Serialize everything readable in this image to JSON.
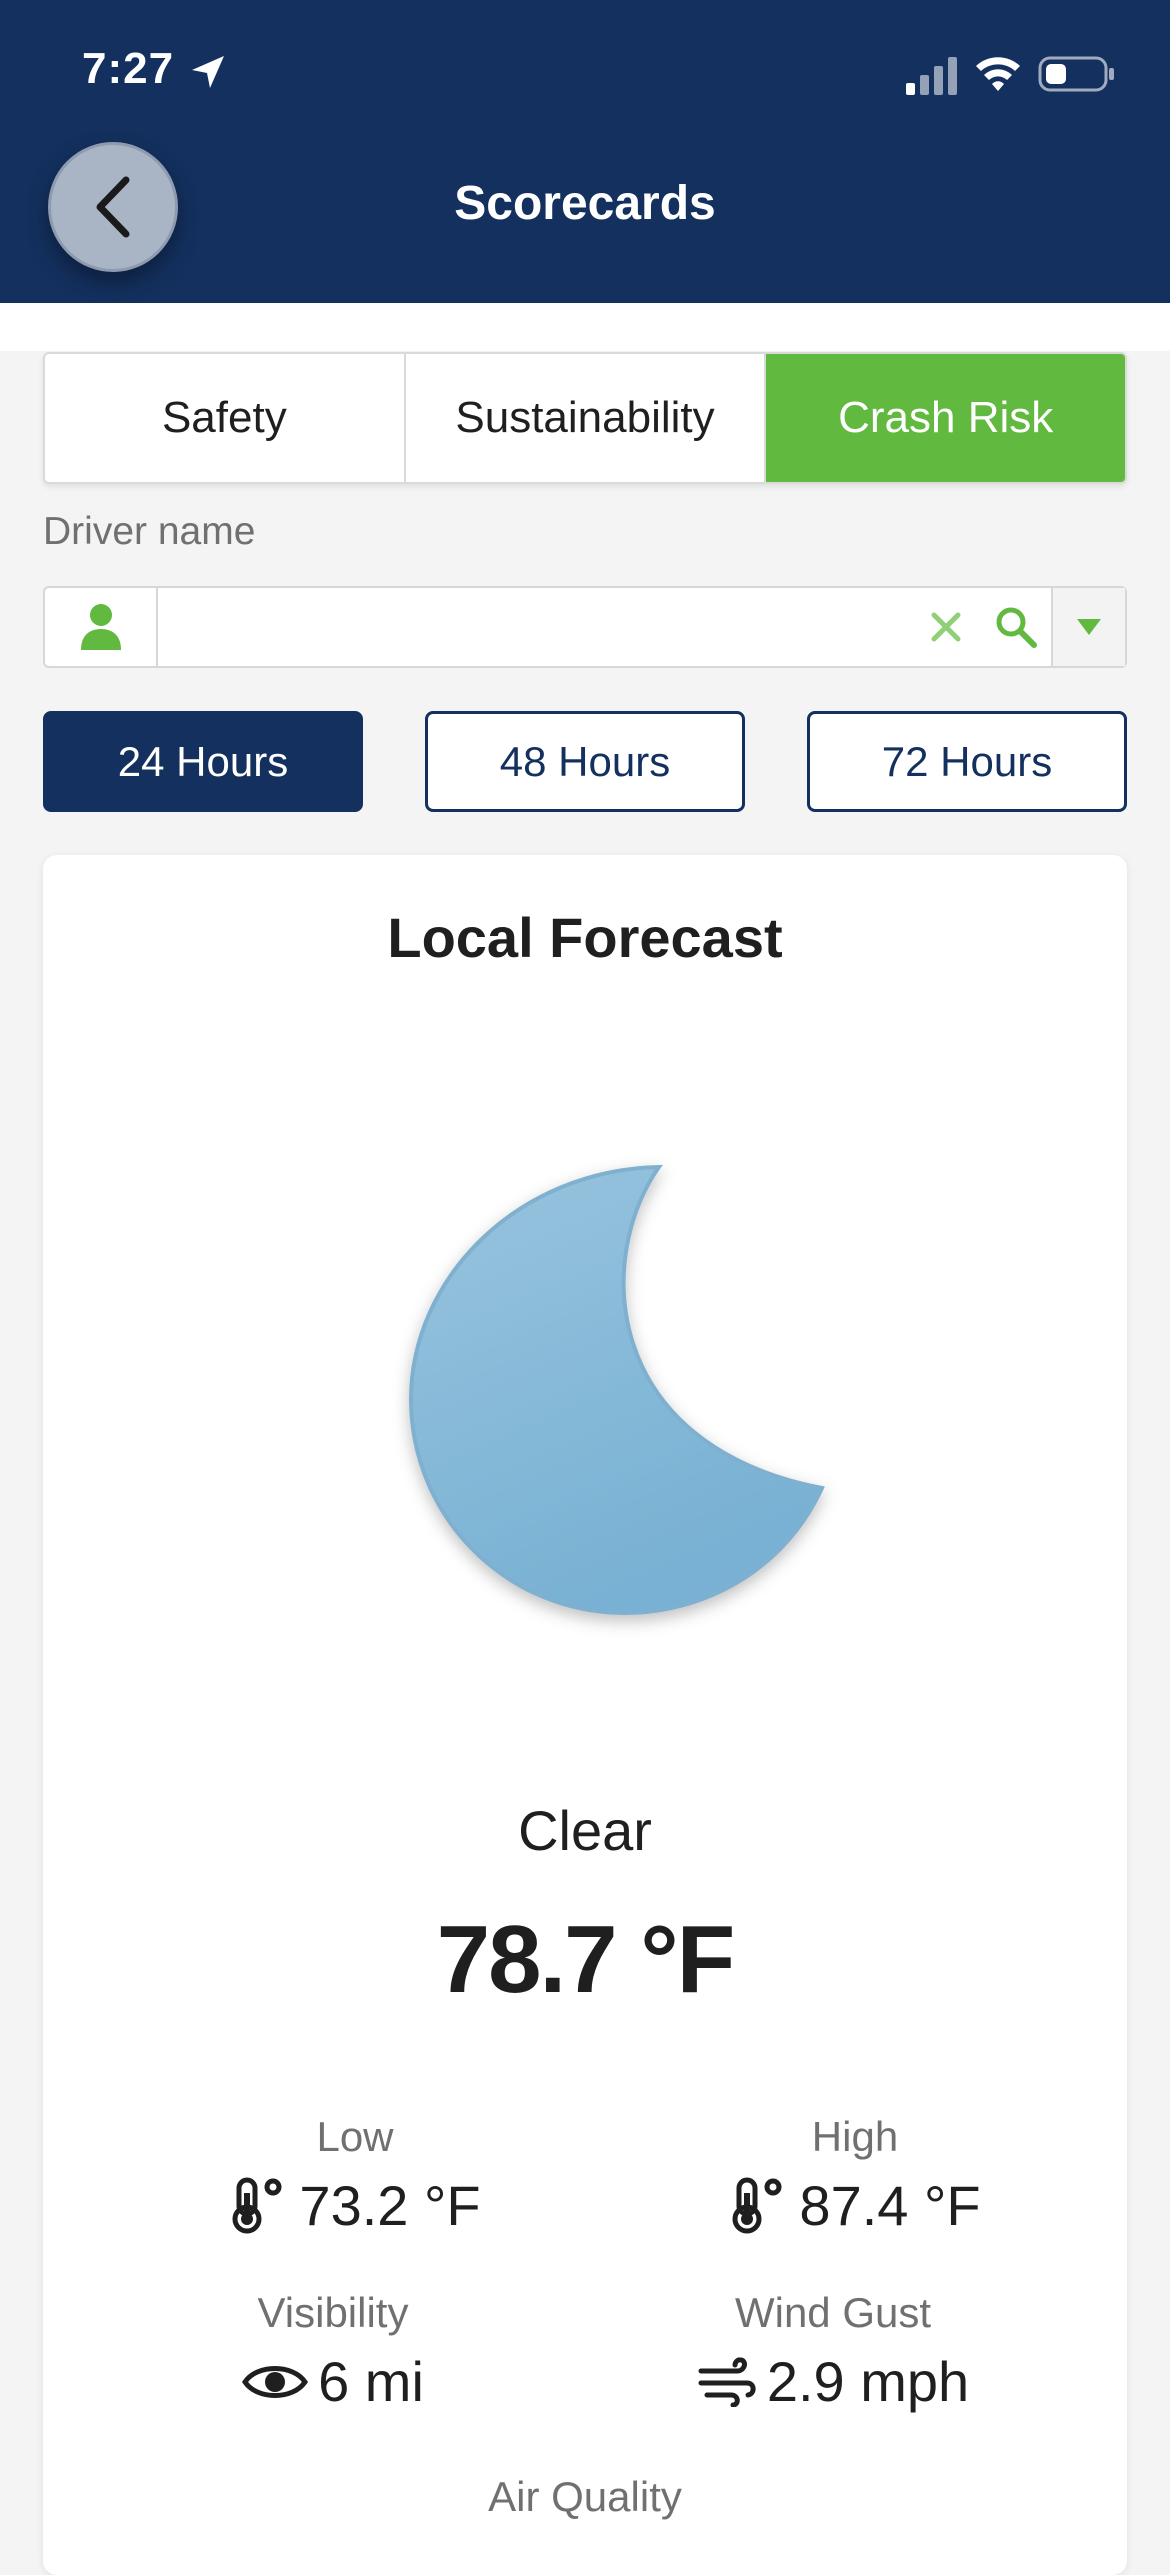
{
  "status_bar": {
    "time": "7:27"
  },
  "header": {
    "title": "Scorecards"
  },
  "tabs": [
    {
      "label": "Safety",
      "active": false
    },
    {
      "label": "Sustainability",
      "active": false
    },
    {
      "label": "Crash Risk",
      "active": true
    }
  ],
  "driver": {
    "label": "Driver name",
    "value": "",
    "placeholder": ""
  },
  "hour_filters": [
    {
      "label": "24 Hours",
      "active": true
    },
    {
      "label": "48 Hours",
      "active": false
    },
    {
      "label": "72 Hours",
      "active": false
    }
  ],
  "forecast": {
    "title": "Local Forecast",
    "condition": "Clear",
    "temperature": "78.7 °F",
    "low_label": "Low",
    "low_value": "73.2 °F",
    "high_label": "High",
    "high_value": "87.4 °F",
    "visibility_label": "Visibility",
    "visibility_value": "6 mi",
    "wind_label": "Wind Gust",
    "wind_value": "2.9 mph",
    "air_quality_label": "Air Quality",
    "icon": "moon-icon"
  },
  "colors": {
    "header_bg": "#13305e",
    "accent_green": "#62b93f",
    "moon_blue": "#8dbcd9"
  }
}
